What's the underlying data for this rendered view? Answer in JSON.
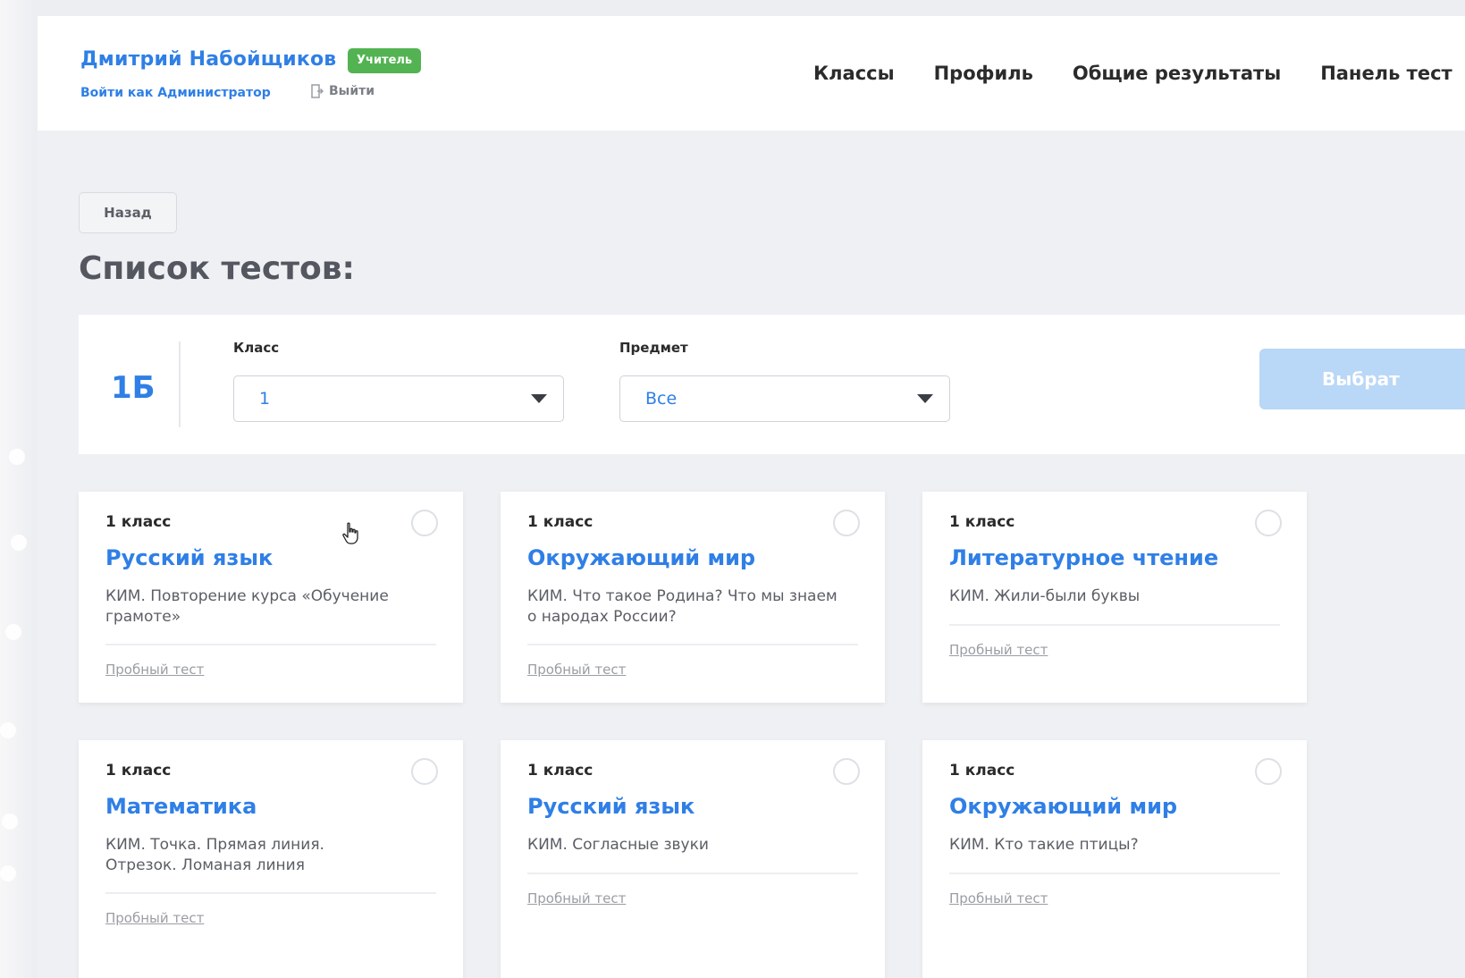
{
  "header": {
    "user_name": "Дмитрий Набойщиков",
    "role_badge": "Учитель",
    "admin_link": "Войти как Администратор",
    "logout": "Выйти",
    "nav": [
      "Классы",
      "Профиль",
      "Общие результаты",
      "Панель тест"
    ]
  },
  "main": {
    "back_button": "Назад",
    "title": "Список тестов:",
    "filter": {
      "class_code": "1Б",
      "class_label": "Класс",
      "class_value": "1",
      "subject_label": "Предмет",
      "subject_value": "Все",
      "choose_button": "Выбрат"
    },
    "cards": [
      {
        "grade": "1 класс",
        "subject": "Русский язык",
        "desc": "КИМ. Повторение курса «Обучение грамоте»",
        "trial": "Пробный тест"
      },
      {
        "grade": "1 класс",
        "subject": "Окружающий мир",
        "desc": "КИМ. Что такое Родина? Что мы знаем о народах России?",
        "trial": "Пробный тест"
      },
      {
        "grade": "1 класс",
        "subject": "Литературное чтение",
        "desc": "КИМ. Жили-были буквы",
        "trial": "Пробный тест"
      },
      {
        "grade": "1 класс",
        "subject": "Математика",
        "desc": "КИМ. Точка. Прямая линия. Отрезок. Ломаная линия",
        "trial": "Пробный тест"
      },
      {
        "grade": "1 класс",
        "subject": "Русский язык",
        "desc": "КИМ. Согласные звуки",
        "trial": "Пробный тест"
      },
      {
        "grade": "1 класс",
        "subject": "Окружающий мир",
        "desc": "КИМ. Кто такие птицы?",
        "trial": "Пробный тест"
      }
    ]
  },
  "colors": {
    "accent": "#2f7fe6",
    "badge": "#53b352",
    "button_disabled": "#b9d7f6"
  },
  "icons": [
    "logout-icon",
    "chevron-down-icon",
    "radio-icon",
    "hand-cursor-icon"
  ]
}
